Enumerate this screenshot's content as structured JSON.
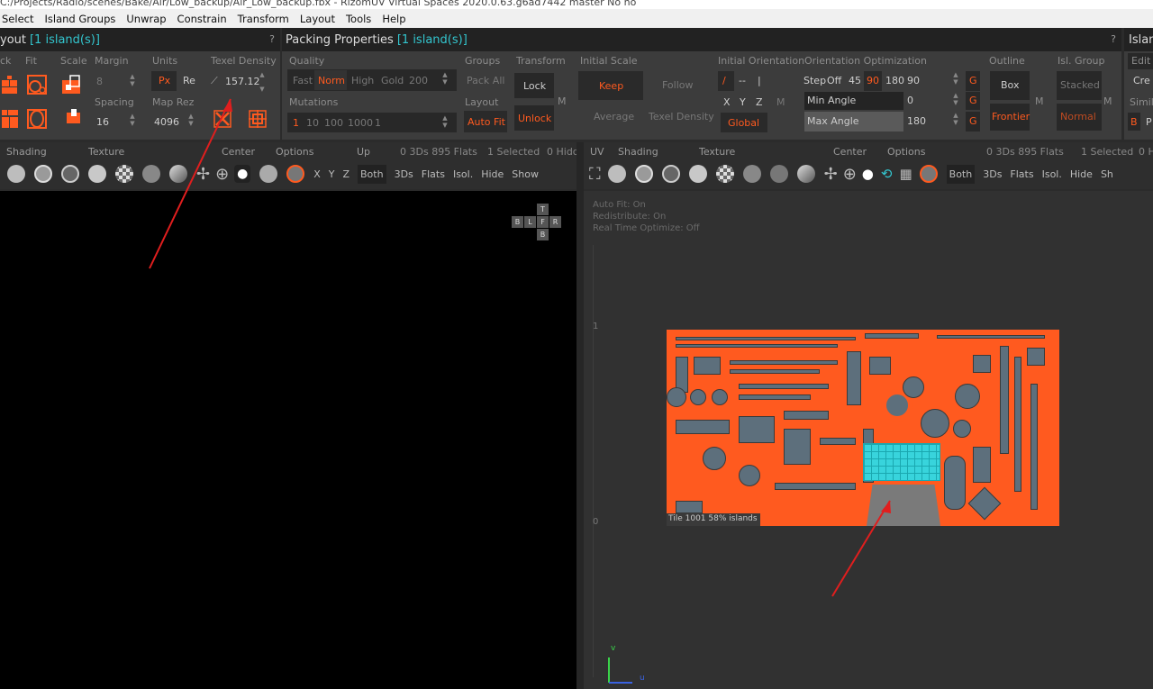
{
  "window": {
    "title": "C:/Projects/Radio/scenes/Bake/Air/Low_backup/Air_Low_backup.fbx - RizomUV  Virtual Spaces 2020.0.63.g6ad7442 master No no"
  },
  "menu": [
    "Select",
    "Island Groups",
    "Unwrap",
    "Constrain",
    "Transform",
    "Layout",
    "Tools",
    "Help"
  ],
  "layout_panel": {
    "title": "yout",
    "count": "[1 island(s)]",
    "help": "?",
    "labels": {
      "pack": "ck",
      "fit": "Fit",
      "scale": "Scale",
      "margin": "Margin",
      "units": "Units",
      "texel_density": "Texel Density",
      "spacing": "Spacing",
      "map_rez": "Map Rez"
    },
    "margin_value": "8",
    "spacing_value": "16",
    "units_px": "Px",
    "units_re": "Re",
    "texel_value": "157.12",
    "map_rez_value": "4096"
  },
  "packing_panel": {
    "title": "Packing Properties",
    "count": "[1 island(s)]",
    "help": "?",
    "labels": {
      "quality": "Quality",
      "groups": "Groups",
      "transform": "Transform",
      "initial_scale": "Initial Scale",
      "initial_orientation": "Initial Orientation",
      "orientation_optimization": "Orientation Optimization",
      "outline": "Outline",
      "isl_group": "Isl. Group",
      "mutations": "Mutations",
      "layout": "Layout"
    },
    "quality": [
      "Fast",
      "Norm",
      "High",
      "Gold"
    ],
    "quality_value": "200",
    "pack_all": "Pack All",
    "lock": "Lock",
    "unlock": "Unlock",
    "auto_fit": "Auto Fit",
    "m": "M",
    "keep": "Keep",
    "follow": "Follow",
    "average": "Average",
    "texel_density": "Texel Density",
    "orient_symbols": [
      "/",
      "--",
      "|"
    ],
    "axes": [
      "X",
      "Y",
      "Z",
      "M"
    ],
    "global": "Global",
    "step": "Step",
    "step_values": [
      "Off",
      "45",
      "90",
      "180",
      "90"
    ],
    "min_angle": "Min Angle",
    "min_angle_value": "0",
    "max_angle": "Max Angle",
    "max_angle_value": "180",
    "g": "G",
    "box": "Box",
    "frontier": "Frontier",
    "stacked": "Stacked",
    "normal": "Normal",
    "mutations": [
      "1",
      "10",
      "100",
      "1000",
      "1"
    ]
  },
  "island_panel": {
    "title": "Islan",
    "labels": [
      "Edit",
      "Cre",
      "Simil"
    ],
    "b": "B",
    "p": "P"
  },
  "toolbar_3d": {
    "labels": [
      "Shading",
      "Texture",
      "Center",
      "Options",
      "Up"
    ],
    "stats": "0 3Ds 895 Flats",
    "selected": "1 Selected",
    "hide_label": "0 Hidd",
    "axes": [
      "X",
      "Y",
      "Z"
    ],
    "buttons": [
      "Both",
      "3Ds",
      "Flats",
      "Isol.",
      "Hide",
      "Show"
    ]
  },
  "toolbar_uv": {
    "labels": [
      "UV",
      "Shading",
      "Texture",
      "Center",
      "Options"
    ],
    "stats": "0 3Ds 895 Flats",
    "selected": "1 Selected",
    "hide_label": "0 H",
    "buttons": [
      "Both",
      "3Ds",
      "Flats",
      "Isol.",
      "Hide",
      "Sh"
    ]
  },
  "viewport_3d": {
    "gizmo": {
      "top": "T",
      "bottom": "B",
      "left": "B",
      "l": "L",
      "f": "F",
      "r": "R"
    }
  },
  "viewport_uv": {
    "info": [
      "Auto Fit: On",
      "Redistribute: On",
      "Real Time Optimize: Off"
    ],
    "axis_one": "1",
    "axis_zero": "0",
    "tile_label": "Tile 1001 58%   islands",
    "axis_u": "u",
    "axis_v": "v"
  },
  "colors": {
    "accent": "#ff5a1f",
    "cyan": "#33c6cf",
    "arrow": "#e01e1e"
  }
}
